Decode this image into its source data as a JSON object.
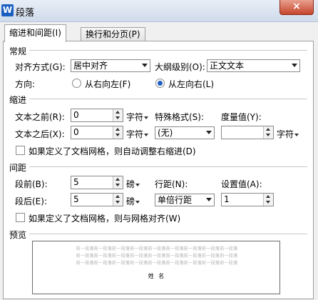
{
  "window": {
    "title": "段落",
    "close_glyph": "×"
  },
  "tabs": [
    {
      "label": "缩进和间距(I)"
    },
    {
      "label": "换行和分页(P)"
    }
  ],
  "general": {
    "heading": "常规",
    "alignment": {
      "label": "对齐方式(G):",
      "value": "居中对齐"
    },
    "outline": {
      "label": "大纲级别(O):",
      "value": "正文文本"
    },
    "direction": {
      "label": "方向:",
      "rtl_label": "从右向左(F)",
      "ltr_label": "从左向右(L)",
      "selected": "ltr"
    }
  },
  "indent": {
    "heading": "缩进",
    "before": {
      "label": "文本之前(R):",
      "value": "0",
      "unit": "字符"
    },
    "after": {
      "label": "文本之后(X):",
      "value": "0",
      "unit": "字符"
    },
    "special": {
      "label": "特殊格式(S):",
      "value": "(无)"
    },
    "measure": {
      "label": "度量值(Y):",
      "value": "",
      "unit": "字符"
    },
    "auto_adjust": {
      "label": "如果定义了文档网格，则自动调整右缩进(D)",
      "checked": false
    }
  },
  "spacing": {
    "heading": "间距",
    "before": {
      "label": "段前(B):",
      "value": "5",
      "unit": "磅"
    },
    "after": {
      "label": "段后(E):",
      "value": "5",
      "unit": "磅"
    },
    "line": {
      "label": "行距(N):",
      "value": "单倍行距"
    },
    "setting": {
      "label": "设置值(A):",
      "value": "1"
    },
    "snap_grid": {
      "label": "如果定义了文档网格，则与网格对齐(W)",
      "checked": false
    }
  },
  "preview": {
    "heading": "预览",
    "sample_line": "前一段落前一段落前一段落前一段落前一段落前一段落前一段落前一段落前一段落",
    "text": "姓 名"
  }
}
